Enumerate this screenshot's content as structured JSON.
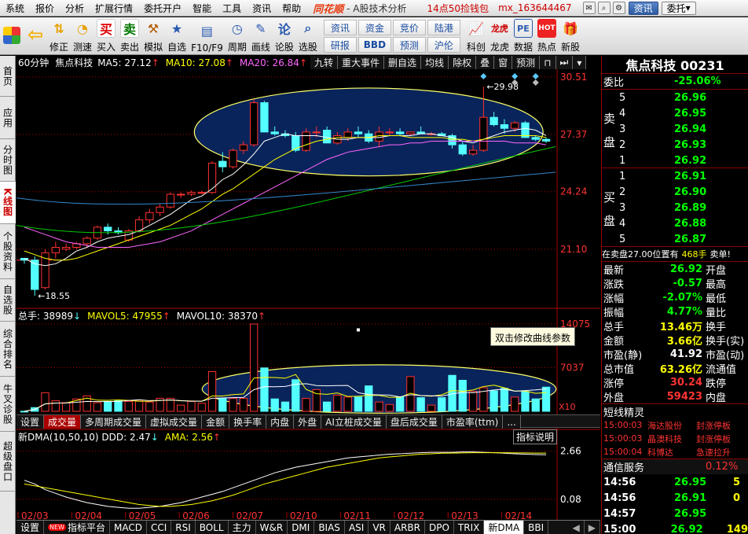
{
  "menubar": {
    "items": [
      "系统",
      "报价",
      "分析",
      "扩展行情",
      "委托开户",
      "智能",
      "工具",
      "资讯",
      "帮助"
    ],
    "brand": "同花顺",
    "subtitle": "- A股技术分析",
    "promo": "14点50捡钱包",
    "userid": "mx_163644467",
    "btn_news": "资讯",
    "btn_trade": "委托"
  },
  "toolbar": {
    "buttons": [
      {
        "label": "修正",
        "icon": "arrow-up-down-icon"
      },
      {
        "label": "测速",
        "icon": "speed-test-icon"
      },
      {
        "label": "买入",
        "icon": "buy-icon",
        "glyph": "买"
      },
      {
        "label": "卖出",
        "icon": "sell-icon",
        "glyph": "卖"
      },
      {
        "label": "模拟",
        "icon": "hammer-icon"
      },
      {
        "label": "自选",
        "icon": "star-icon"
      },
      {
        "label": "F10/F9",
        "icon": "f10-icon"
      },
      {
        "label": "周期",
        "icon": "cycle-icon"
      },
      {
        "label": "画线",
        "icon": "pen-icon"
      },
      {
        "label": "论股",
        "icon": "discuss-icon",
        "glyph": "论"
      },
      {
        "label": "选股",
        "icon": "magnifier-icon"
      }
    ],
    "grid": [
      "资讯",
      "资金",
      "竞价",
      "陆港",
      "研报",
      "BBD",
      "预测",
      "沪伦"
    ],
    "right_buttons": [
      {
        "label": "科创",
        "icon": "chart-icon"
      },
      {
        "label": "龙虎",
        "icon": "dragon-icon",
        "glyph": "龙虎"
      },
      {
        "label": "数据",
        "icon": "pe-icon",
        "glyph": "PE"
      },
      {
        "label": "热点",
        "icon": "hot-icon",
        "glyph": "HOT"
      },
      {
        "label": "新股",
        "icon": "new-stock-icon"
      }
    ]
  },
  "left_tabs": [
    "首页",
    "应用",
    "分时图",
    "K线图",
    "个股资料",
    "自选股",
    "综合排名",
    "牛叉诊股",
    "超级盘口"
  ],
  "chart_header": {
    "period": "60分钟",
    "name": "焦点科技",
    "ma5_label": "MA5: 27.12",
    "ma10_label": "MA10: 27.08",
    "ma20_label": "MA20: 26.84",
    "buttons": [
      "九转",
      "重大事件",
      "删自选",
      "均线",
      "除权",
      "叠",
      "窗",
      "预测"
    ]
  },
  "volume_header": {
    "vol": "总手: 38989",
    "mavol5": "MAVOL5: 47955",
    "mavol10": "MAVOL10: 38370"
  },
  "mid_tabs": [
    "设置",
    "成交量",
    "多周期成交量",
    "虚拟成交量",
    "金额",
    "换手率",
    "内盘",
    "外盘",
    "AI立桩成交量",
    "盘后成交量",
    "市盈率(ttm)",
    "..."
  ],
  "dma_header": {
    "label": "新DMA(10,50,10)  DDD: 2.47",
    "ama": "AMA: 2.56",
    "btn": "指标说明"
  },
  "tooltip": "双击修改曲线参数",
  "chart_data": [
    {
      "type": "candlestick",
      "title": "",
      "yticks": [
        21.1,
        24.24,
        27.37,
        30.51
      ],
      "annotations": [
        "29.98",
        "18.55"
      ],
      "dates": [
        "02/03",
        "02/04",
        "02/05",
        "02/06",
        "02/07",
        "02/10",
        "02/11",
        "02/12",
        "02/13",
        "02/14"
      ],
      "ohlc": [
        [
          20.6,
          20.6,
          20.3,
          20.5
        ],
        [
          20.5,
          20.7,
          18.55,
          18.9
        ],
        [
          19.0,
          21.1,
          18.9,
          20.9
        ],
        [
          20.9,
          21.5,
          20.6,
          21.2
        ],
        [
          21.1,
          21.4,
          21.0,
          21.2
        ],
        [
          21.2,
          21.5,
          21.1,
          21.4
        ],
        [
          21.4,
          21.8,
          21.2,
          21.7
        ],
        [
          21.7,
          22.4,
          21.6,
          22.3
        ],
        [
          22.3,
          22.5,
          21.9,
          22.1
        ],
        [
          22.1,
          22.3,
          21.9,
          22.0
        ],
        [
          21.6,
          22.2,
          21.5,
          22.1
        ],
        [
          22.1,
          22.9,
          22.0,
          22.7
        ],
        [
          22.7,
          23.3,
          22.5,
          23.1
        ],
        [
          23.1,
          23.6,
          22.9,
          23.4
        ],
        [
          23.4,
          24.2,
          23.3,
          24.1
        ],
        [
          24.1,
          24.2,
          23.9,
          24.1
        ],
        [
          24.1,
          24.3,
          24.0,
          24.2
        ],
        [
          24.2,
          24.3,
          24.1,
          24.2
        ],
        [
          24.2,
          25.9,
          24.1,
          25.8
        ],
        [
          25.9,
          26.4,
          25.3,
          25.6
        ],
        [
          25.6,
          26.6,
          25.5,
          26.5
        ],
        [
          26.5,
          27.0,
          26.3,
          26.8
        ],
        [
          26.8,
          29.3,
          26.7,
          29.1
        ],
        [
          29.1,
          29.2,
          27.8,
          27.5
        ],
        [
          27.5,
          27.8,
          27.3,
          27.4
        ],
        [
          27.4,
          27.6,
          27.2,
          27.3
        ],
        [
          27.3,
          27.5,
          26.4,
          26.5
        ],
        [
          26.5,
          27.7,
          26.4,
          27.5
        ],
        [
          27.5,
          27.8,
          27.2,
          27.5
        ],
        [
          27.6,
          27.8,
          27.3,
          26.9
        ],
        [
          26.9,
          27.5,
          26.8,
          27.3
        ],
        [
          27.2,
          27.7,
          27.0,
          27.5
        ],
        [
          27.5,
          27.8,
          27.2,
          27.4
        ],
        [
          27.4,
          27.6,
          26.9,
          27.0
        ],
        [
          27.0,
          27.8,
          26.7,
          27.5
        ],
        [
          27.5,
          27.7,
          27.3,
          27.5
        ],
        [
          27.5,
          27.7,
          27.3,
          27.4
        ],
        [
          27.4,
          27.5,
          27.3,
          27.5
        ],
        [
          27.5,
          27.8,
          27.4,
          27.4
        ],
        [
          27.4,
          27.5,
          27.3,
          27.4
        ],
        [
          27.4,
          27.5,
          27.3,
          27.3
        ],
        [
          27.3,
          27.4,
          26.6,
          26.8
        ],
        [
          26.8,
          27.0,
          26.2,
          26.3
        ],
        [
          26.3,
          26.8,
          26.2,
          26.5
        ],
        [
          26.5,
          29.98,
          26.4,
          28.3
        ],
        [
          28.3,
          28.6,
          27.8,
          27.9
        ],
        [
          27.9,
          28.2,
          27.4,
          27.7
        ],
        [
          27.7,
          28.1,
          27.5,
          28.0
        ],
        [
          28.0,
          28.1,
          27.2,
          27.2
        ],
        [
          27.2,
          27.3,
          27.0,
          27.1
        ],
        [
          27.1,
          27.2,
          26.9,
          27.0
        ]
      ],
      "ma5": [
        20.6,
        20.3,
        20.2,
        20.3,
        20.6,
        21.0,
        21.2,
        21.5,
        21.7,
        21.8,
        21.9,
        22.1,
        22.4,
        22.7,
        23.0,
        23.4,
        23.8,
        24.0,
        24.4,
        24.9,
        25.2,
        25.7,
        26.3,
        27.0,
        27.2,
        27.4,
        27.3,
        27.3,
        27.3,
        27.2,
        27.1,
        27.1,
        27.2,
        27.2,
        27.2,
        27.3,
        27.3,
        27.3,
        27.4,
        27.4,
        27.3,
        27.2,
        27.0,
        26.9,
        27.1,
        27.3,
        27.5,
        27.6,
        27.7,
        27.6,
        27.3
      ],
      "ma10": [
        21.0,
        20.8,
        20.6,
        20.5,
        20.5,
        20.6,
        20.8,
        21.0,
        21.2,
        21.4,
        21.6,
        21.8,
        22.0,
        22.2,
        22.4,
        22.7,
        23.0,
        23.3,
        23.7,
        24.1,
        24.4,
        24.8,
        25.2,
        25.6,
        26.0,
        26.3,
        26.6,
        26.8,
        27.0,
        27.1,
        27.2,
        27.2,
        27.2,
        27.2,
        27.3,
        27.3,
        27.3,
        27.2,
        27.2,
        27.2,
        27.2,
        27.1,
        27.1,
        27.0,
        27.1,
        27.2,
        27.3,
        27.3,
        27.3,
        27.3,
        27.2
      ],
      "ma20": [
        22.3,
        22.1,
        21.9,
        21.7,
        21.5,
        21.4,
        21.3,
        21.2,
        21.2,
        21.2,
        21.2,
        21.3,
        21.4,
        21.5,
        21.7,
        21.9,
        22.1,
        22.4,
        22.7,
        23.0,
        23.3,
        23.6,
        23.9,
        24.2,
        24.5,
        24.8,
        25.1,
        25.4,
        25.7,
        26.0,
        26.2,
        26.4,
        26.5,
        26.6,
        26.7,
        26.8,
        26.8,
        26.9,
        26.9,
        27.0,
        27.0,
        27.0,
        27.0,
        27.0,
        27.0,
        27.0,
        27.0,
        26.9,
        26.9,
        26.9,
        26.8
      ]
    },
    {
      "type": "bar",
      "title": "",
      "yticks": [
        7037,
        14075
      ],
      "unit_label": "X10",
      "series_name": "总手",
      "values": [
        10,
        600,
        3000,
        1700,
        1400,
        2000,
        2500,
        1400,
        1600,
        1700,
        1600,
        1800,
        1500,
        2100,
        2100,
        1000,
        1600,
        1300,
        6400,
        2100,
        2100,
        2100,
        14075,
        7000,
        2000,
        1500,
        5100,
        2100,
        3500,
        1500,
        2600,
        2300,
        2300,
        4100,
        1500,
        1100,
        2300,
        5600,
        2200,
        1000,
        2200,
        5800,
        5000,
        3200,
        3800,
        3300,
        3700,
        2300,
        3200,
        2000,
        3900
      ],
      "mavol5_last": 47955,
      "mavol10_last": 38370
    },
    {
      "type": "line",
      "title": "",
      "yticks": [
        0.08,
        2.66
      ],
      "series": [
        {
          "name": "DDD",
          "values": [
            1.1,
            0.9,
            0.6,
            0.4,
            0.2,
            0.05,
            -0.1,
            -0.2,
            -0.3,
            -0.35,
            -0.4,
            -0.4,
            -0.35,
            -0.3,
            -0.2,
            -0.1,
            0.05,
            0.2,
            0.35,
            0.5,
            0.7,
            0.9,
            1.1,
            1.3,
            1.5,
            1.65,
            1.8,
            1.9,
            2.0,
            2.1,
            2.2,
            2.3,
            2.35,
            2.4,
            2.45,
            2.5,
            2.52,
            2.55,
            2.58,
            2.6,
            2.6,
            2.6,
            2.62,
            2.62,
            2.6,
            2.58,
            2.55,
            2.52,
            2.5,
            2.48,
            2.47
          ]
        },
        {
          "name": "AMA",
          "values": [
            0.9,
            0.8,
            0.7,
            0.6,
            0.5,
            0.4,
            0.3,
            0.2,
            0.1,
            0.0,
            -0.1,
            -0.2,
            -0.25,
            -0.3,
            -0.3,
            -0.25,
            -0.2,
            -0.1,
            0.0,
            0.15,
            0.3,
            0.5,
            0.7,
            0.9,
            1.05,
            1.2,
            1.35,
            1.5,
            1.65,
            1.8,
            1.9,
            2.0,
            2.1,
            2.2,
            2.3,
            2.35,
            2.4,
            2.45,
            2.5,
            2.52,
            2.55,
            2.56,
            2.57,
            2.58,
            2.58,
            2.58,
            2.58,
            2.57,
            2.57,
            2.56,
            2.56
          ]
        }
      ]
    }
  ],
  "right_panel": {
    "title": "焦点科技 00231",
    "weibi_label": "委比",
    "weibi_value": "-25.06%",
    "sell_label": [
      "卖",
      "盘"
    ],
    "buy_label": [
      "买",
      "盘"
    ],
    "sell": [
      {
        "lv": "5",
        "p": "26.96"
      },
      {
        "lv": "4",
        "p": "26.95"
      },
      {
        "lv": "3",
        "p": "26.94"
      },
      {
        "lv": "2",
        "p": "26.93"
      },
      {
        "lv": "1",
        "p": "26.92"
      }
    ],
    "buy": [
      {
        "lv": "1",
        "p": "26.91"
      },
      {
        "lv": "2",
        "p": "26.90"
      },
      {
        "lv": "3",
        "p": "26.89"
      },
      {
        "lv": "4",
        "p": "26.88"
      },
      {
        "lv": "5",
        "p": "26.87"
      }
    ],
    "pending": "在卖盘27.00位置有",
    "pending_qty": "468手",
    "pending_tail": "卖单!",
    "stats": [
      {
        "k": "最新",
        "v": "26.92",
        "k2": "开盘",
        "c": "#0f0"
      },
      {
        "k": "涨跌",
        "v": "-0.57",
        "k2": "最高",
        "c": "#0f0"
      },
      {
        "k": "涨幅",
        "v": "-2.07%",
        "k2": "最低",
        "c": "#0f0"
      },
      {
        "k": "振幅",
        "v": "4.77%",
        "k2": "量比",
        "c": "#0f0"
      },
      {
        "k": "总手",
        "v": "13.46万",
        "k2": "换手",
        "c": "#ff0"
      },
      {
        "k": "金额",
        "v": "3.66亿",
        "k2": "换手(实)",
        "c": "#ff0"
      },
      {
        "k": "市盈(静)",
        "v": "41.92",
        "k2": "市盈(动)",
        "c": "#fff"
      },
      {
        "k": "总市值",
        "v": "63.26亿",
        "k2": "流通值",
        "c": "#ff0"
      },
      {
        "k": "涨停",
        "v": "30.24",
        "k2": "跌停",
        "c": "#f33"
      },
      {
        "k": "外盘",
        "v": "59423",
        "k2": "内盘",
        "c": "#f33"
      }
    ],
    "news_title": "短线精灵",
    "news": [
      {
        "t": "15:00:03",
        "n": "海达股份",
        "e": "封涨停板"
      },
      {
        "t": "15:00:03",
        "n": "晶澳科技",
        "e": "封涨停板"
      },
      {
        "t": "15:00:04",
        "n": "科博达",
        "e": "急速拉升"
      }
    ],
    "status_label": "通信服务",
    "status_value": "0.12%",
    "ticks": [
      {
        "t": "14:56",
        "p": "26.95",
        "q": "5"
      },
      {
        "t": "14:56",
        "p": "26.91",
        "q": "0"
      },
      {
        "t": "14:57",
        "p": "26.95",
        "q": ""
      },
      {
        "t": "15:00",
        "p": "26.92",
        "q": "149"
      }
    ]
  },
  "bottom_tabs": [
    "设置",
    "指标平台",
    "MACD",
    "CCI",
    "RSI",
    "BOLL",
    "主力",
    "W&R",
    "DMI",
    "BIAS",
    "ASI",
    "VR",
    "ARBR",
    "DPO",
    "TRIX",
    "新DMA",
    "BBI"
  ],
  "bottom_new_badge": "NEW",
  "colors": {
    "up": "#ff3030",
    "down": "#54ffff",
    "ma5": "#ffffff",
    "ma10": "#ffff00",
    "ma20": "#ff66ff",
    "ellipse": "#ffff66",
    "ellipse_fill": "#0a2a6a"
  }
}
